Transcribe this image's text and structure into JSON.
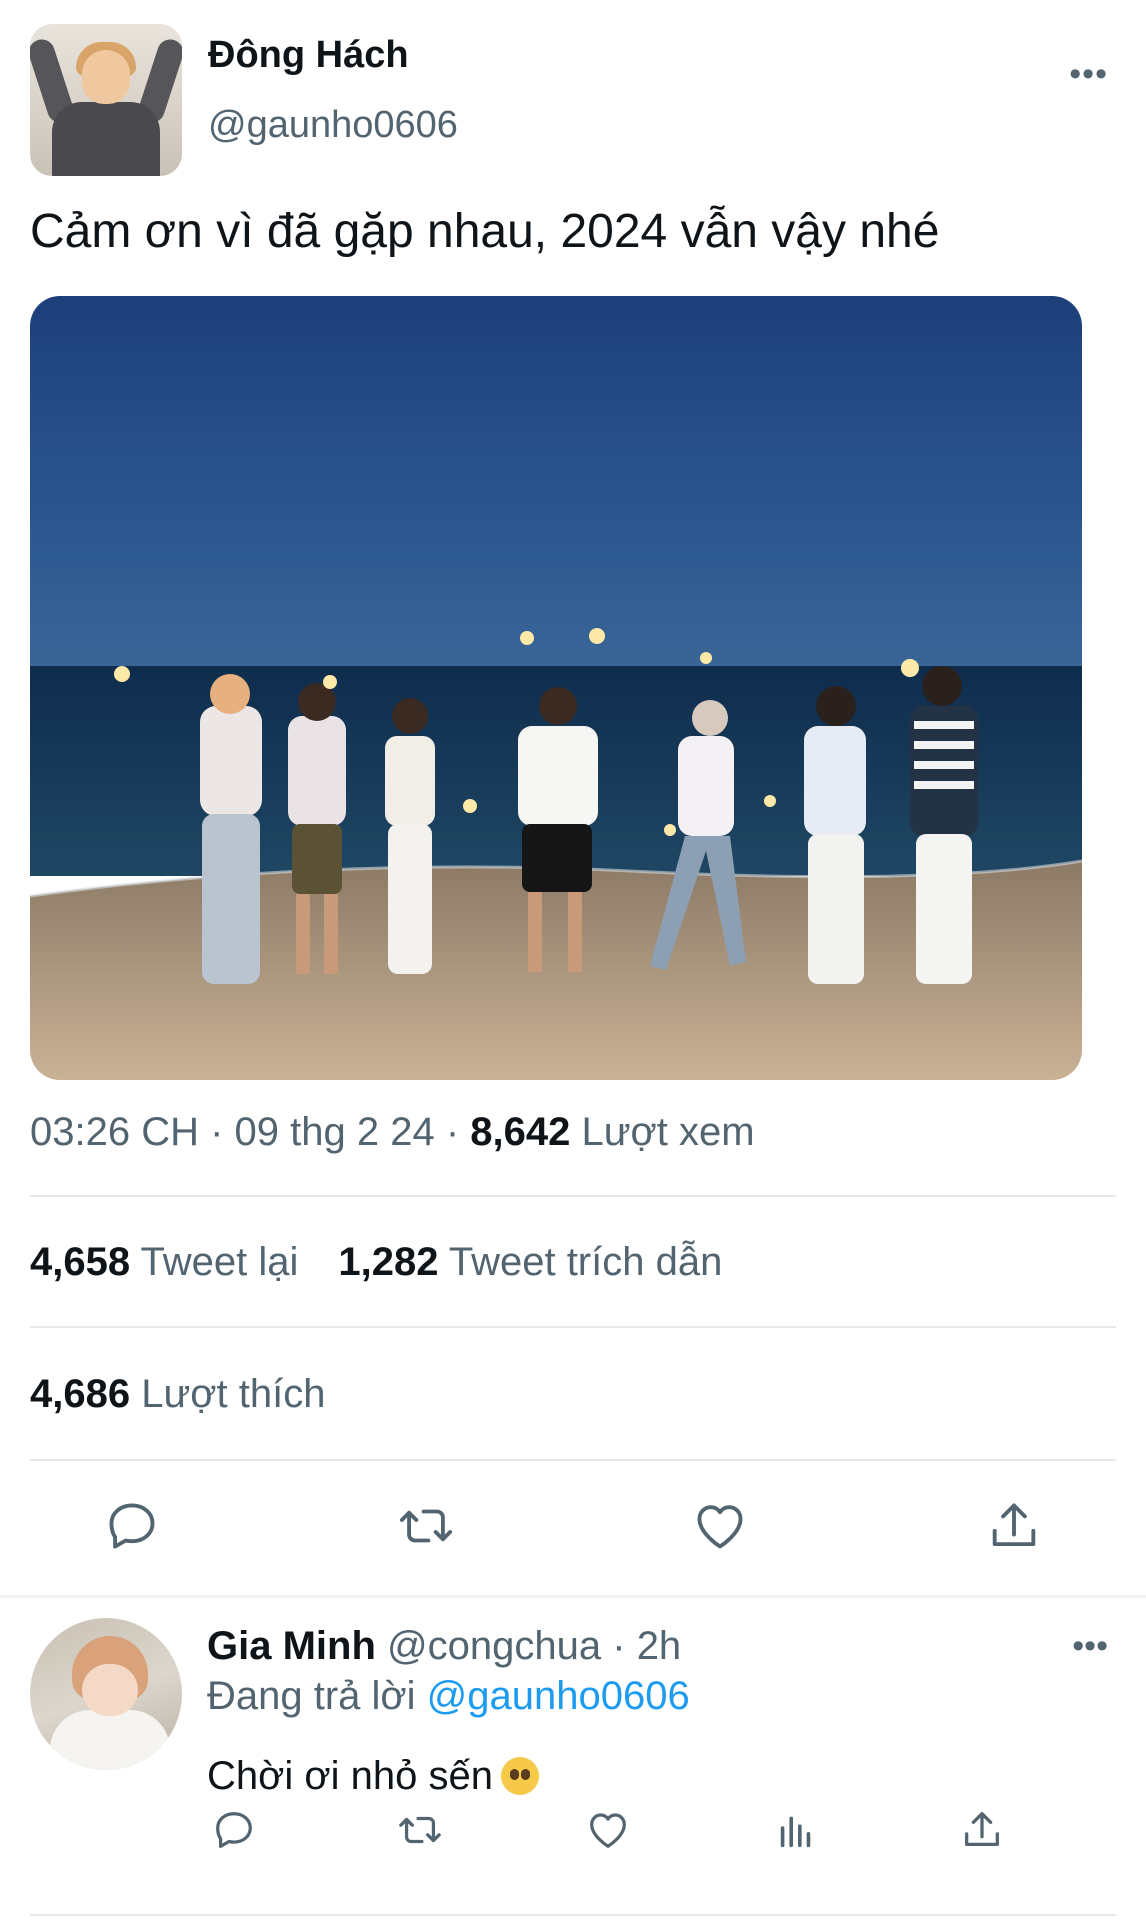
{
  "tweet": {
    "author_name": "Đông Hách",
    "author_handle": "@gaunho0606",
    "more_icon": "more-horizontal-icon",
    "text": "Cảm ơn vì đã gặp nhau, 2024 vẫn vậy nhé",
    "time": "03:26 CH",
    "date": "09 thg 2 24",
    "views_count": "8,642",
    "views_label": "Lượt xem",
    "retweets_count": "4,658",
    "retweets_label": "Tweet lại",
    "quotes_count": "1,282",
    "quotes_label": "Tweet trích dẫn",
    "likes_count": "4,686",
    "likes_label": "Lượt thích",
    "actions": [
      "reply-icon",
      "retweet-icon",
      "like-icon",
      "share-icon"
    ]
  },
  "reply": {
    "author_name": "Gia Minh",
    "author_handle": "@congchua",
    "separator": "·",
    "time": "2h",
    "replying_label": "Đang trả lời",
    "replying_to": "@gaunho0606",
    "text": "Chời ơi nhỏ sến",
    "emoji": "pleading-face",
    "actions": [
      "reply-icon",
      "retweet-icon",
      "like-icon",
      "analytics-icon",
      "share-icon"
    ]
  },
  "colors": {
    "text_primary": "#0f1419",
    "text_secondary": "#536471",
    "link": "#1d9bf0",
    "divider": "#e6e9eb"
  }
}
